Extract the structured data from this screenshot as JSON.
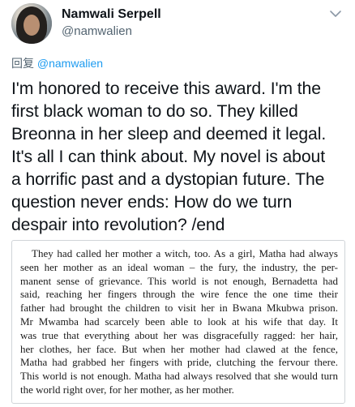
{
  "author": {
    "display_name": "Namwali Serpell",
    "handle": "@namwalien",
    "avatar_icon": "profile-photo"
  },
  "reply": {
    "prefix": "回复",
    "mention": "@namwalien"
  },
  "tweet": {
    "lines": [
      "I'm honored to receive this award. I'm the",
      "first black woman to do so. They killed",
      "Breonna in her sleep and deemed it legal.",
      "It's all I can think about. My novel is about",
      "a horrific past and a dystopian future. The",
      "question never ends: How do we turn",
      "despair into revolution? /end"
    ]
  },
  "excerpt": {
    "lines": [
      "They had called her mother a witch, too. As a girl, Matha had always",
      "seen her mother as an ideal woman – the fury, the industry, the per-",
      "manent sense of grievance. This world is not enough, Bernadetta had",
      "said, reaching her fingers through the wire fence the one time their",
      "father had brought the children to visit her in Bwana Mkubwa prison.",
      "Mr Mwamba had scarcely been able to look at his wife that day. It",
      "was true that everything about her was disgracefully ragged: her hair,",
      "her clothes, her face. But when her mother had clawed at the fence,",
      "Matha had grabbed her fingers with pride, clutching the fervour there.",
      "This world is not enough. Matha had always resolved that she would turn",
      "the world right over, for her mother, as her mother."
    ]
  },
  "colors": {
    "text": "#0f1419",
    "secondary": "#536471",
    "accent": "#1d9bf0"
  }
}
